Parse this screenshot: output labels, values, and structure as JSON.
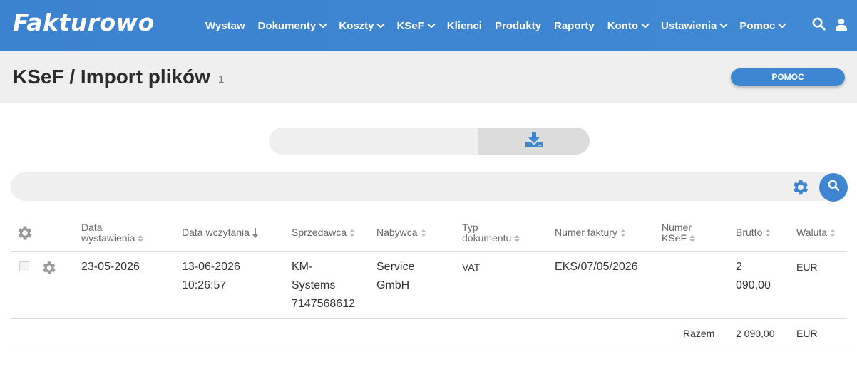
{
  "app": {
    "logo": "Fakturowo"
  },
  "nav": {
    "items": [
      {
        "label": "Wystaw",
        "dropdown": false
      },
      {
        "label": "Dokumenty",
        "dropdown": true
      },
      {
        "label": "Koszty",
        "dropdown": true
      },
      {
        "label": "KSeF",
        "dropdown": true
      },
      {
        "label": "Klienci",
        "dropdown": false
      },
      {
        "label": "Produkty",
        "dropdown": false
      },
      {
        "label": "Raporty",
        "dropdown": false
      },
      {
        "label": "Konto",
        "dropdown": true
      },
      {
        "label": "Ustawienia",
        "dropdown": true
      },
      {
        "label": "Pomoc",
        "dropdown": true
      }
    ],
    "icons": [
      "search-icon",
      "user-icon"
    ]
  },
  "page": {
    "title": "KSeF / Import plików",
    "count": "1",
    "help_label": "POMOC"
  },
  "colors": {
    "brand": "#3f86d2",
    "icon_gray": "#888888",
    "title_bg": "#efefef"
  },
  "table": {
    "headers": {
      "date_issued": [
        "Data",
        "wystawienia"
      ],
      "date_loaded": "Data wczytania",
      "seller": "Sprzedawca",
      "buyer": "Nabywca",
      "doc_type": [
        "Typ",
        "dokumentu"
      ],
      "invoice_no": "Numer faktury",
      "ksef_no": [
        "Numer",
        "KSeF"
      ],
      "gross": "Brutto",
      "currency": "Waluta"
    },
    "rows": [
      {
        "date_issued": "23-05-2026",
        "date_loaded": [
          "13-06-2026",
          "10:26:57"
        ],
        "seller": [
          "KM-",
          "Systems",
          "7147568612"
        ],
        "buyer": [
          "Service",
          "GmbH"
        ],
        "doc_type": "VAT",
        "invoice_no": "EKS/07/05/2026",
        "ksef_no": "",
        "gross": [
          "2",
          "090,00"
        ],
        "currency": "EUR"
      }
    ],
    "footer": {
      "label": "Razem",
      "gross": "2 090,00",
      "currency": "EUR"
    }
  }
}
